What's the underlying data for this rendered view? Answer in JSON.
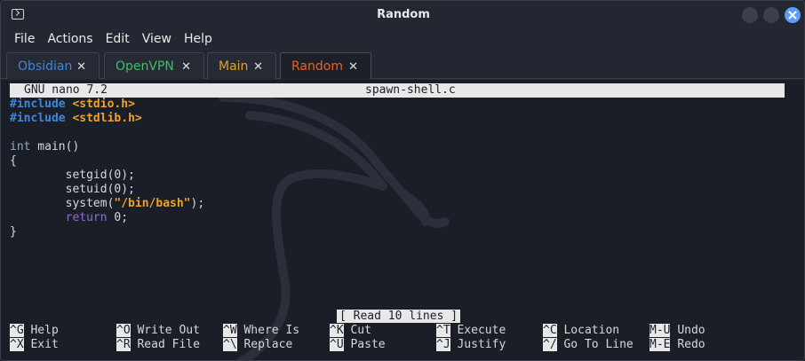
{
  "window": {
    "title": "Random"
  },
  "menu": [
    "File",
    "Actions",
    "Edit",
    "View",
    "Help"
  ],
  "tabs": [
    {
      "label": "Obsidian",
      "color": "#3f86d8",
      "active": false
    },
    {
      "label": "OpenVPN",
      "color": "#3fbf6a",
      "active": false
    },
    {
      "label": "Main",
      "color": "#e0a030",
      "active": false
    },
    {
      "label": "Random",
      "color": "#e8622a",
      "active": true
    }
  ],
  "tab_close_glyph": "✕",
  "nano": {
    "version": "GNU nano 7.2",
    "filename": "spawn-shell.c",
    "status": "[ Read 10 lines ]"
  },
  "code": {
    "line1": {
      "kw": "#include",
      "hdr": "<stdio.h>"
    },
    "line2": {
      "kw": "#include",
      "hdr": "<stdlib.h>"
    },
    "line4": {
      "type": "int",
      "rest": " main()"
    },
    "line5": "{",
    "line6": "        setgid(0);",
    "line7": "        setuid(0);",
    "line8": {
      "pre": "        system(",
      "str": "\"/bin/bash\"",
      "post": ");"
    },
    "line9": {
      "pre": "        ",
      "kw": "return",
      "post": " 0;"
    },
    "line10": "}"
  },
  "shortcuts": [
    {
      "key": "^G",
      "label": "Help"
    },
    {
      "key": "^X",
      "label": "Exit"
    },
    {
      "key": "^O",
      "label": "Write Out"
    },
    {
      "key": "^R",
      "label": "Read File"
    },
    {
      "key": "^W",
      "label": "Where Is"
    },
    {
      "key": "^\\",
      "label": "Replace"
    },
    {
      "key": "^K",
      "label": "Cut"
    },
    {
      "key": "^U",
      "label": "Paste"
    },
    {
      "key": "^T",
      "label": "Execute"
    },
    {
      "key": "^J",
      "label": "Justify"
    },
    {
      "key": "^C",
      "label": "Location"
    },
    {
      "key": "^/",
      "label": "Go To Line"
    },
    {
      "key": "M-U",
      "label": "Undo"
    },
    {
      "key": "M-E",
      "label": "Redo"
    }
  ]
}
